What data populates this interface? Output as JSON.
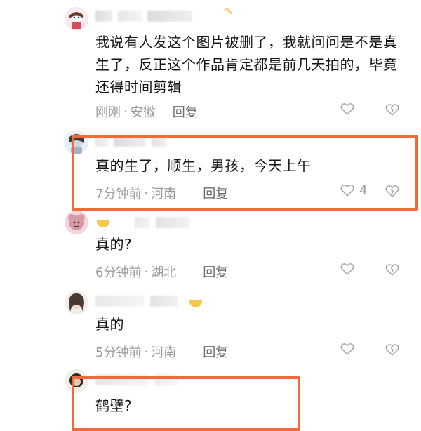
{
  "comments": [
    {
      "text": "我说有人发这个图片被删了，我就问问是不是真生了，反正这个作品肯定都是前几天拍的，毕竟还得时间剪辑",
      "time": "刚刚",
      "location": "安徽",
      "reply_label": "回复",
      "likes": ""
    },
    {
      "text": "真的生了，顺生，男孩，今天上午",
      "time": "7分钟前",
      "location": "河南",
      "reply_label": "回复",
      "likes": "4"
    },
    {
      "text": "真的?",
      "time": "6分钟前",
      "location": "湖北",
      "reply_label": "回复",
      "likes": ""
    },
    {
      "text": "真的",
      "time": "5分钟前",
      "location": "河南",
      "reply_label": "回复",
      "likes": ""
    },
    {
      "text": "鹤壁?",
      "time": "",
      "location": "",
      "reply_label": "",
      "likes": ""
    }
  ],
  "meta_separator": "·",
  "icons": {
    "like": "heart-outline-icon",
    "dislike": "broken-heart-outline-icon"
  },
  "colors": {
    "highlight": "#f26a3a",
    "meta": "#9a9a9a"
  }
}
